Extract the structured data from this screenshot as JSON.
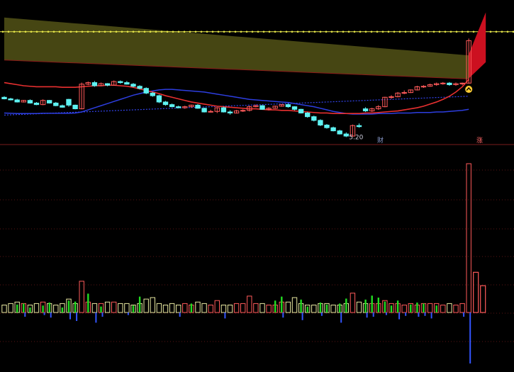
{
  "colors": {
    "background": "#000000",
    "up": "#ff5a5a",
    "down": "#5ef2f2",
    "ma_short": "#e83030",
    "ma_long": "#2d3ee0",
    "band_fill": "#4a4a14",
    "dotted_line": "#e8e84a",
    "vol_up": "#ff5a5a",
    "vol_down": "#5ef2f2",
    "green_bar": "#22dd22",
    "blue_bar": "#3355ff",
    "grid": "#5a1414",
    "arrow": "#ffcc33",
    "marker": "#8899cc"
  },
  "annotations": {
    "low_price": "5.20",
    "marker_cai": "财",
    "marker_zhang": "涨"
  },
  "chart_data": [
    {
      "type": "candlestick",
      "candles": [
        [
          12.8,
          13.0,
          12.4,
          12.5
        ],
        [
          12.5,
          12.7,
          12.2,
          12.3
        ],
        [
          12.3,
          12.5,
          11.8,
          11.9
        ],
        [
          11.9,
          12.3,
          11.8,
          12.2
        ],
        [
          12.2,
          12.4,
          11.6,
          11.7
        ],
        [
          11.7,
          11.9,
          11.3,
          11.4
        ],
        [
          11.4,
          12.4,
          11.3,
          12.2
        ],
        [
          12.2,
          12.3,
          11.6,
          11.7
        ],
        [
          11.7,
          11.9,
          11.1,
          11.2
        ],
        [
          11.2,
          11.4,
          10.8,
          10.9
        ],
        [
          12.4,
          12.5,
          11.0,
          11.3
        ],
        [
          11.3,
          11.4,
          10.5,
          10.6
        ],
        [
          10.6,
          15.6,
          10.5,
          15.3
        ],
        [
          15.3,
          15.8,
          15.1,
          15.6
        ],
        [
          15.6,
          15.9,
          14.8,
          15.0
        ],
        [
          15.0,
          15.6,
          14.9,
          15.4
        ],
        [
          15.4,
          15.5,
          14.9,
          15.1
        ],
        [
          15.1,
          16.0,
          15.0,
          15.8
        ],
        [
          15.8,
          16.0,
          15.4,
          15.6
        ],
        [
          15.6,
          15.9,
          15.2,
          15.3
        ],
        [
          15.3,
          15.5,
          14.7,
          14.9
        ],
        [
          14.9,
          15.1,
          14.3,
          14.5
        ],
        [
          14.5,
          14.7,
          13.4,
          13.6
        ],
        [
          13.6,
          13.8,
          12.9,
          13.1
        ],
        [
          13.1,
          13.3,
          11.7,
          11.9
        ],
        [
          11.9,
          12.1,
          11.2,
          11.4
        ],
        [
          11.4,
          11.6,
          10.9,
          11.0
        ],
        [
          11.0,
          11.2,
          10.7,
          10.8
        ],
        [
          10.8,
          11.2,
          10.6,
          11.0
        ],
        [
          11.0,
          11.4,
          10.8,
          11.3
        ],
        [
          11.3,
          11.5,
          10.6,
          10.7
        ],
        [
          10.7,
          10.8,
          9.9,
          10.0
        ],
        [
          10.0,
          10.4,
          9.9,
          10.1
        ],
        [
          10.1,
          10.9,
          9.8,
          10.8
        ],
        [
          10.8,
          11.0,
          9.9,
          10.0
        ],
        [
          10.0,
          10.3,
          9.5,
          9.8
        ],
        [
          9.8,
          10.4,
          9.7,
          10.2
        ],
        [
          10.2,
          10.5,
          10.0,
          10.3
        ],
        [
          10.3,
          11.2,
          10.1,
          11.0
        ],
        [
          11.0,
          11.4,
          10.9,
          11.2
        ],
        [
          11.2,
          11.3,
          10.4,
          10.5
        ],
        [
          10.5,
          10.9,
          10.3,
          10.7
        ],
        [
          10.7,
          11.2,
          10.6,
          11.1
        ],
        [
          11.1,
          11.5,
          11.0,
          11.4
        ],
        [
          11.4,
          11.6,
          10.8,
          11.0
        ],
        [
          11.0,
          11.1,
          10.3,
          10.5
        ],
        [
          10.5,
          10.6,
          9.7,
          9.8
        ],
        [
          9.8,
          10.0,
          8.9,
          9.1
        ],
        [
          9.1,
          9.3,
          8.2,
          8.4
        ],
        [
          8.4,
          8.6,
          7.3,
          7.5
        ],
        [
          7.5,
          7.7,
          6.8,
          7.0
        ],
        [
          7.0,
          7.2,
          6.3,
          6.4
        ],
        [
          6.4,
          6.6,
          5.7,
          5.8
        ],
        [
          5.8,
          6.1,
          5.2,
          5.4
        ],
        [
          5.4,
          7.6,
          5.3,
          7.4
        ],
        [
          7.4,
          7.8,
          7.0,
          7.2
        ],
        [
          10.6,
          10.9,
          10.0,
          10.2
        ],
        [
          10.2,
          10.8,
          10.0,
          10.6
        ],
        [
          10.6,
          11.3,
          10.4,
          11.0
        ],
        [
          11.0,
          12.9,
          10.9,
          12.8
        ],
        [
          12.8,
          13.2,
          12.5,
          12.9
        ],
        [
          12.9,
          13.8,
          12.8,
          13.6
        ],
        [
          13.6,
          14.1,
          13.4,
          13.7
        ],
        [
          13.7,
          14.3,
          13.6,
          14.2
        ],
        [
          14.2,
          15.0,
          14.1,
          14.8
        ],
        [
          14.8,
          15.1,
          14.6,
          14.9
        ],
        [
          14.9,
          15.4,
          14.8,
          15.2
        ],
        [
          15.2,
          15.6,
          15.0,
          15.4
        ],
        [
          15.4,
          15.7,
          15.2,
          15.5
        ],
        [
          15.5,
          15.7,
          15.0,
          15.2
        ],
        [
          15.2,
          15.6,
          15.0,
          15.4
        ],
        [
          15.4,
          15.6,
          15.1,
          15.5
        ],
        [
          15.5,
          24.0,
          15.4,
          23.6
        ]
      ],
      "ma_short": [
        15.6,
        15.4,
        15.2,
        15.0,
        14.9,
        14.8,
        14.8,
        14.8,
        14.8,
        14.7,
        14.7,
        14.7,
        14.8,
        14.9,
        15.0,
        15.0,
        15.1,
        15.1,
        15.0,
        14.9,
        14.7,
        14.4,
        14.1,
        13.8,
        13.5,
        13.1,
        12.8,
        12.5,
        12.2,
        11.9,
        11.7,
        11.5,
        11.3,
        11.1,
        11.0,
        10.9,
        10.8,
        10.7,
        10.6,
        10.6,
        10.5,
        10.4,
        10.4,
        10.3,
        10.3,
        10.2,
        10.1,
        10.0,
        9.9,
        9.8,
        9.8,
        9.7,
        9.7,
        9.7,
        9.7,
        9.7,
        9.8,
        9.8,
        9.9,
        10.0,
        10.1,
        10.2,
        10.4,
        10.6,
        10.8,
        11.1,
        11.5,
        11.9,
        12.4,
        13.0,
        13.8,
        14.8,
        16.2
      ],
      "ma_long": [
        9.4,
        9.45,
        9.5,
        9.55,
        9.6,
        9.65,
        9.7,
        9.75,
        9.8,
        9.85,
        9.9,
        9.95,
        10.0,
        10.05,
        10.1,
        10.15,
        10.2,
        10.25,
        10.3,
        10.35,
        10.4,
        10.45,
        10.5,
        10.55,
        10.6,
        10.65,
        10.7,
        10.75,
        10.8,
        10.85,
        10.9,
        10.95,
        11.0,
        11.05,
        11.1,
        11.15,
        11.2,
        11.25,
        11.3,
        11.35,
        11.4,
        11.45,
        11.5,
        11.55,
        11.6,
        11.65,
        11.7,
        11.75,
        11.8,
        11.85,
        11.9,
        11.95,
        12.0,
        12.05,
        12.1,
        12.15,
        12.2,
        12.25,
        12.3,
        12.35,
        12.4,
        12.45,
        12.5,
        12.55,
        12.6,
        12.65,
        12.7,
        12.75,
        12.8,
        12.85,
        12.9,
        12.95,
        13.0
      ],
      "ma_blue": [
        9.8,
        9.75,
        9.7,
        9.7,
        9.7,
        9.7,
        9.75,
        9.75,
        9.75,
        9.75,
        9.75,
        9.8,
        10.0,
        10.4,
        10.8,
        11.2,
        11.6,
        12.0,
        12.4,
        12.8,
        13.2,
        13.5,
        13.8,
        14.0,
        14.2,
        14.3,
        14.3,
        14.2,
        14.1,
        14.0,
        13.9,
        13.8,
        13.6,
        13.4,
        13.2,
        13.0,
        12.8,
        12.6,
        12.4,
        12.3,
        12.2,
        12.1,
        12.0,
        11.9,
        11.8,
        11.6,
        11.4,
        11.2,
        11.0,
        10.7,
        10.4,
        10.1,
        9.9,
        9.7,
        9.6,
        9.6,
        9.6,
        9.6,
        9.7,
        9.7,
        9.7,
        9.8,
        9.8,
        9.8,
        9.9,
        9.9,
        9.9,
        10.0,
        10.0,
        10.1,
        10.2,
        10.3,
        10.5
      ],
      "band_upper": [
        28.0,
        27.9,
        27.8,
        27.7,
        27.6,
        27.5,
        27.4,
        27.3,
        27.2,
        27.1,
        27.0,
        26.9,
        26.8,
        26.7,
        26.6,
        26.5,
        26.4,
        26.3,
        26.2,
        26.1,
        26.0,
        25.9,
        25.8,
        25.7,
        25.6,
        25.5,
        25.4,
        25.3,
        25.2,
        25.1,
        25.0,
        24.9,
        24.8,
        24.7,
        24.6,
        24.5,
        24.4,
        24.3,
        24.2,
        24.1,
        24.0,
        23.9,
        23.8,
        23.7,
        23.6,
        23.5,
        23.4,
        23.3,
        23.2,
        23.1,
        23.0,
        22.9,
        22.8,
        22.7,
        22.6,
        22.5,
        22.4,
        22.3,
        22.2,
        22.1,
        22.0,
        21.9,
        21.8,
        21.7,
        21.6,
        21.5,
        21.4,
        21.3,
        21.2,
        21.1,
        21.0,
        20.9,
        20.8
      ],
      "band_lower": [
        19.9,
        19.85,
        19.8,
        19.75,
        19.7,
        19.65,
        19.6,
        19.55,
        19.5,
        19.45,
        19.4,
        19.35,
        19.3,
        19.25,
        19.2,
        19.15,
        19.1,
        19.05,
        19.0,
        18.95,
        18.9,
        18.85,
        18.8,
        18.75,
        18.7,
        18.65,
        18.6,
        18.55,
        18.5,
        18.45,
        18.4,
        18.35,
        18.3,
        18.25,
        18.2,
        18.15,
        18.1,
        18.05,
        18.0,
        17.95,
        17.9,
        17.85,
        17.8,
        17.75,
        17.7,
        17.65,
        17.6,
        17.55,
        17.5,
        17.45,
        17.4,
        17.35,
        17.3,
        17.25,
        17.2,
        17.15,
        17.1,
        17.05,
        17.0,
        16.95,
        16.9,
        16.85,
        16.8,
        16.75,
        16.7,
        16.65,
        16.6,
        16.55,
        16.5,
        16.45,
        16.4,
        16.35,
        16.3
      ],
      "resistance_level": 25.3,
      "ylim": [
        5.0,
        30.0
      ],
      "min_label_value": 5.2
    },
    {
      "type": "bar",
      "volume": [
        5,
        6,
        7,
        6,
        5,
        6,
        7,
        6,
        5,
        6,
        9,
        6,
        21,
        7,
        6,
        6,
        7,
        7,
        6,
        6,
        5,
        6,
        9,
        10,
        6,
        5,
        6,
        5,
        6,
        5,
        7,
        6,
        5,
        8,
        5,
        5,
        6,
        6,
        11,
        6,
        6,
        5,
        5,
        7,
        7,
        10,
        6,
        5,
        5,
        6,
        6,
        5,
        5,
        6,
        13,
        7,
        6,
        6,
        6,
        8,
        6,
        6,
        5,
        6,
        5,
        6,
        6,
        6,
        5,
        6,
        5,
        6,
        100
      ],
      "volume_extra": [
        {
          "value": 27,
          "color": "up"
        },
        {
          "value": 18,
          "color": "up"
        }
      ],
      "green_bars": [
        0,
        0,
        8,
        9,
        5,
        0,
        7,
        10,
        0,
        5,
        12,
        11,
        0,
        19,
        0,
        6,
        0,
        0,
        0,
        0,
        7,
        16,
        0,
        0,
        0,
        0,
        0,
        0,
        0,
        9,
        0,
        0,
        0,
        0,
        0,
        0,
        0,
        0,
        0,
        0,
        0,
        0,
        12,
        16,
        0,
        0,
        13,
        6,
        0,
        10,
        8,
        0,
        9,
        14,
        0,
        0,
        13,
        17,
        15,
        11,
        7,
        12,
        0,
        8,
        10,
        9,
        0,
        7,
        0,
        0,
        0,
        0,
        0
      ],
      "blue_bars": [
        0,
        0,
        0,
        -5,
        0,
        0,
        -3,
        -6,
        0,
        0,
        -8,
        -10,
        0,
        0,
        -12,
        -5,
        0,
        0,
        0,
        -3,
        0,
        0,
        0,
        0,
        0,
        0,
        0,
        -5,
        0,
        0,
        0,
        0,
        0,
        0,
        -7,
        0,
        0,
        0,
        0,
        0,
        0,
        0,
        0,
        -6,
        0,
        0,
        -9,
        0,
        0,
        -4,
        0,
        0,
        -12,
        0,
        0,
        0,
        -6,
        -5,
        0,
        -3,
        0,
        -8,
        -4,
        0,
        -5,
        -4,
        -7,
        0,
        0,
        0,
        0,
        -5,
        -60
      ],
      "ylim": [
        -60,
        110
      ]
    }
  ]
}
